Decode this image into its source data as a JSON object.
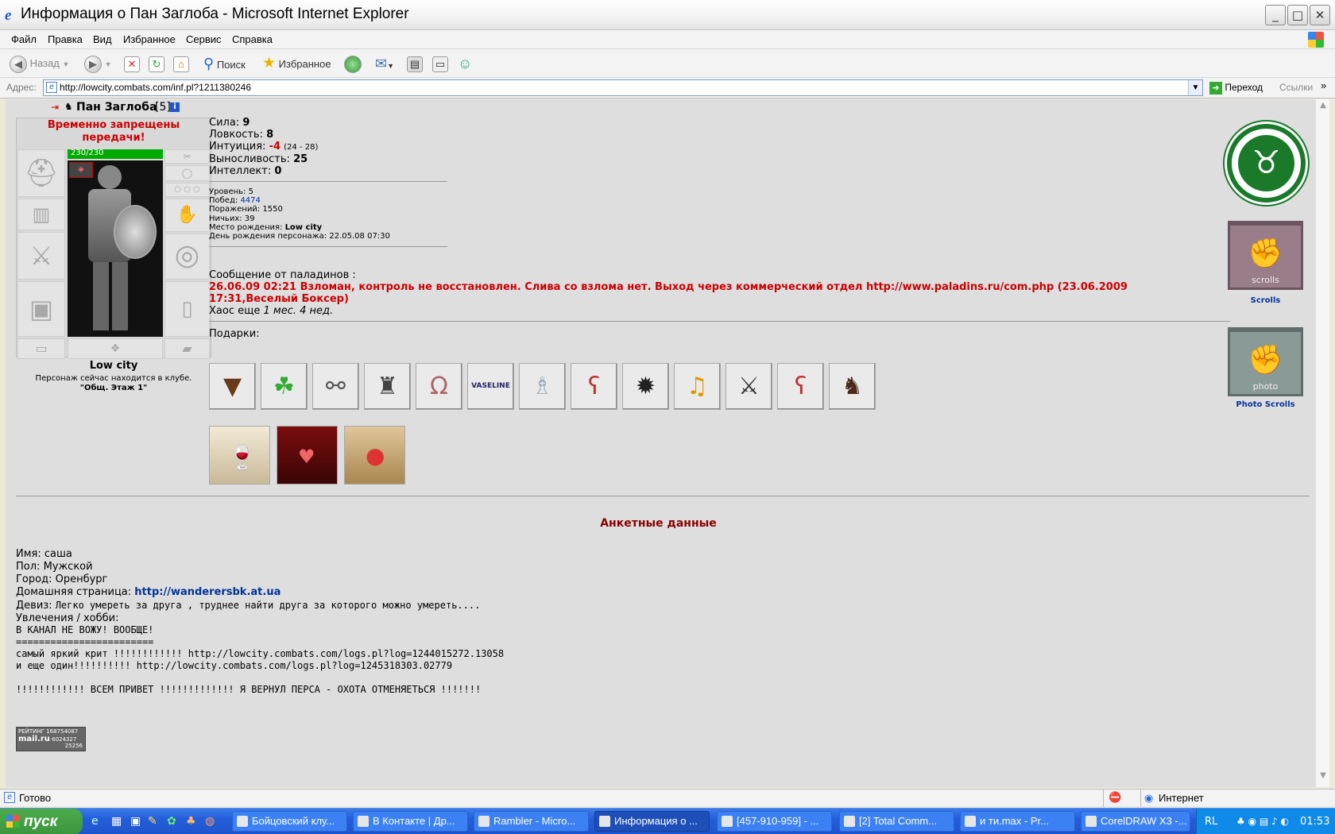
{
  "window": {
    "title": "Информация о Пан Заглоба - Microsoft Internet Explorer"
  },
  "menu": [
    "Файл",
    "Правка",
    "Вид",
    "Избранное",
    "Сервис",
    "Справка"
  ],
  "toolbar": {
    "back": "Назад",
    "search": "Поиск",
    "favorites": "Избранное"
  },
  "address": {
    "label": "Адрес:",
    "url": "http://lowcity.combats.com/inf.pl?1211380246",
    "go": "Переход",
    "links": "Ссылки"
  },
  "profile": {
    "name": "Пан Заглоба",
    "level_badge": "[5]",
    "ban": "Временно запрещены передачи!",
    "hp": "230/230",
    "hp_fraction": 1.0,
    "city": "Low city",
    "location_note": "Персонаж сейчас находится в клубе.",
    "location": "\"Общ. Этаж 1\""
  },
  "stats": [
    {
      "label": "Сила:",
      "value": "9",
      "extra": ""
    },
    {
      "label": "Ловкость:",
      "value": "8",
      "extra": ""
    },
    {
      "label": "Интуиция:",
      "value": "-4",
      "extra": "(24 - 28)"
    },
    {
      "label": "Выносливость:",
      "value": "25",
      "extra": ""
    },
    {
      "label": "Интеллект:",
      "value": "0",
      "extra": ""
    }
  ],
  "info": [
    {
      "label": "Уровень:",
      "value": "5"
    },
    {
      "label": "Побед:",
      "value": "4474"
    },
    {
      "label": "Поражений:",
      "value": "1550"
    },
    {
      "label": "Ничьих:",
      "value": "39"
    },
    {
      "label": "Место рождения:",
      "value": "Low city"
    },
    {
      "label": "День рождения персонажа:",
      "value": "22.05.08 07:30"
    }
  ],
  "paladin": {
    "heading": "Сообщение от паладинов :",
    "line1": "26.06.09 02:21 Взломан, контроль не восстановлен. Слива со взлома нет. Выход через коммерческий отдел http://www.paladins.ru/com.php (23.06.2009",
    "line2": "17:31,Веселый Боксер)",
    "chaos_prefix": "Хаос еще",
    "chaos_time": "1 мес. 4 нед."
  },
  "gifts": {
    "label": "Подарки:",
    "vaseline": "VASELINE"
  },
  "side": {
    "scrolls": "Scrolls",
    "photo_scrolls": "Photo Scrolls",
    "banner_scrolls": "scrolls",
    "banner_photo": "photo"
  },
  "anketa": {
    "heading": "Анкетные данные",
    "name_label": "Имя:",
    "name": "саша",
    "sex_label": "Пол:",
    "sex": "Мужской",
    "city_label": "Город:",
    "city": "Оренбург",
    "home_label": "Домашняя страница:",
    "home": "http://wanderersbk.at.ua",
    "motto_label": "Девиз:",
    "motto": "Легко умереть за друга , труднее найти друга за которого можно умереть....",
    "hobby_label": "Увлечения / хобби:",
    "hobby": [
      "В КАНАЛ НЕ ВОЖУ! ВООБЩЕ!",
      "========================",
      "самый яркий крит !!!!!!!!!!!! http://lowcity.combats.com/logs.pl?log=1244015272.13058",
      "и еще один!!!!!!!!!! http://lowcity.combats.com/logs.pl?log=1245318303.02779",
      "",
      "!!!!!!!!!!!! ВСЕМ ПРИВЕТ !!!!!!!!!!!!! Я ВЕРНУЛ ПЕРСА - ОХОТА ОТМЕНЯЕТЬСЯ !!!!!!!"
    ]
  },
  "counter": {
    "t1": "РЕЙТИНГ",
    "n1": "168754087",
    "t2": "mail.ru",
    "n2": "6024327",
    "n3": "25256"
  },
  "status": {
    "text": "Готово",
    "zone": "Интернет"
  },
  "taskbar": {
    "start": "пуск",
    "tasks": [
      "Бойцовский клу...",
      "В Контакте | Др...",
      "Rambler - Micro...",
      "Информация о ...",
      "[457-910-959] - ...",
      "[2] Total Comm...",
      "и ти.max - Pr...",
      "CorelDRAW X3 -..."
    ],
    "lang": "RL",
    "clock": "01:53"
  },
  "colors": {
    "ban": "#cc0000",
    "paladin": "#cc0000",
    "link": "#003399",
    "heading": "#8b0000",
    "hp": "#00aa00"
  }
}
